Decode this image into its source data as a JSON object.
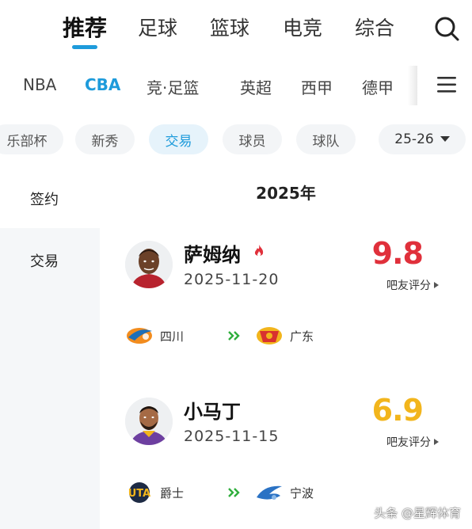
{
  "top_tabs": [
    "推荐",
    "足球",
    "篮球",
    "电竞",
    "综合"
  ],
  "leagues": [
    "NBA",
    "CBA",
    "竞·足篮",
    "英超",
    "西甲",
    "德甲"
  ],
  "chips": [
    "乐部杯",
    "新秀",
    "交易",
    "球员",
    "球队"
  ],
  "season": "25-26",
  "side_nav": [
    "签约",
    "交易"
  ],
  "year_header": "2025年",
  "rating_link_label": "吧友评分",
  "colors": {
    "accent": "#1e9bdb",
    "rating_high": "#e0303b",
    "rating_mid": "#f2b51c"
  },
  "transfers": [
    {
      "player": "萨姆纳",
      "hot": true,
      "date": "2025-11-20",
      "rating": "9.8",
      "rating_color": "#e0303b",
      "from_team": "四川",
      "to_team": "广东"
    },
    {
      "player": "小马丁",
      "hot": false,
      "date": "2025-11-15",
      "rating": "6.9",
      "rating_color": "#f2b51c",
      "from_team": "爵士",
      "to_team": "宁波"
    }
  ],
  "watermark": "头条 @星辉体育"
}
